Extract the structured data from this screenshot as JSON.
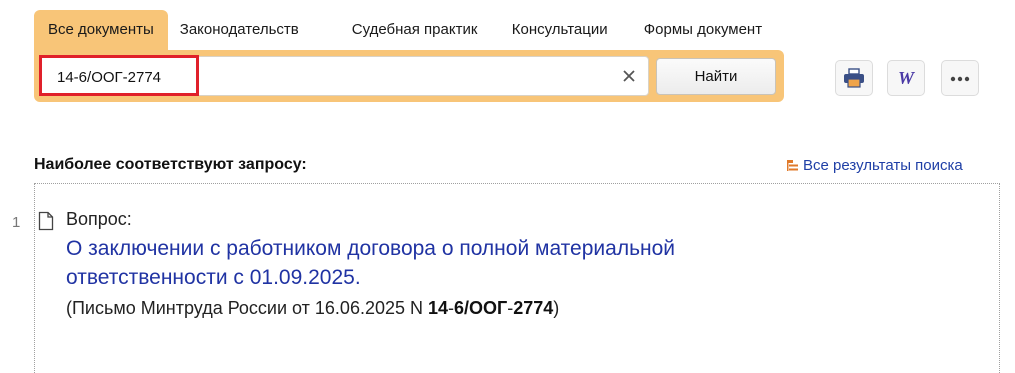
{
  "tabs": [
    {
      "label": "Все документы",
      "active": true
    },
    {
      "label": "Законодательств",
      "active": false
    },
    {
      "label": "Судебная практик",
      "active": false
    },
    {
      "label": "Консультации",
      "active": false
    },
    {
      "label": "Формы документ",
      "active": false
    }
  ],
  "search": {
    "value": "14-6/ООГ-2774",
    "clear_icon": "close-icon",
    "button_label": "Найти"
  },
  "toolbar": {
    "print_icon": "printer-icon",
    "word_icon": "word-icon",
    "word_letter": "W",
    "more_icon": "ellipsis-icon"
  },
  "results": {
    "heading": "Наиболее соответствуют запросу:",
    "all_results_label": "Все результаты поиска",
    "items": [
      {
        "number": "1",
        "type_label": "Вопрос:",
        "link_text": "О заключении с работником договора о полной материальной ответственности с 01.09.2025.",
        "citation": {
          "prefix": "(Письмо Минтруда России от 16.06.2025 N ",
          "code_part1": "14",
          "dash1": "-",
          "code_part2": "6/ООГ",
          "dash2": "-",
          "code_part3": "2774",
          "suffix": ")"
        }
      }
    ]
  },
  "colors": {
    "accent": "#f8c578",
    "link": "#2033a3",
    "highlight": "#e0202a",
    "word_icon": "#4b3aa6",
    "all_results_icon": "#e07a2a"
  }
}
